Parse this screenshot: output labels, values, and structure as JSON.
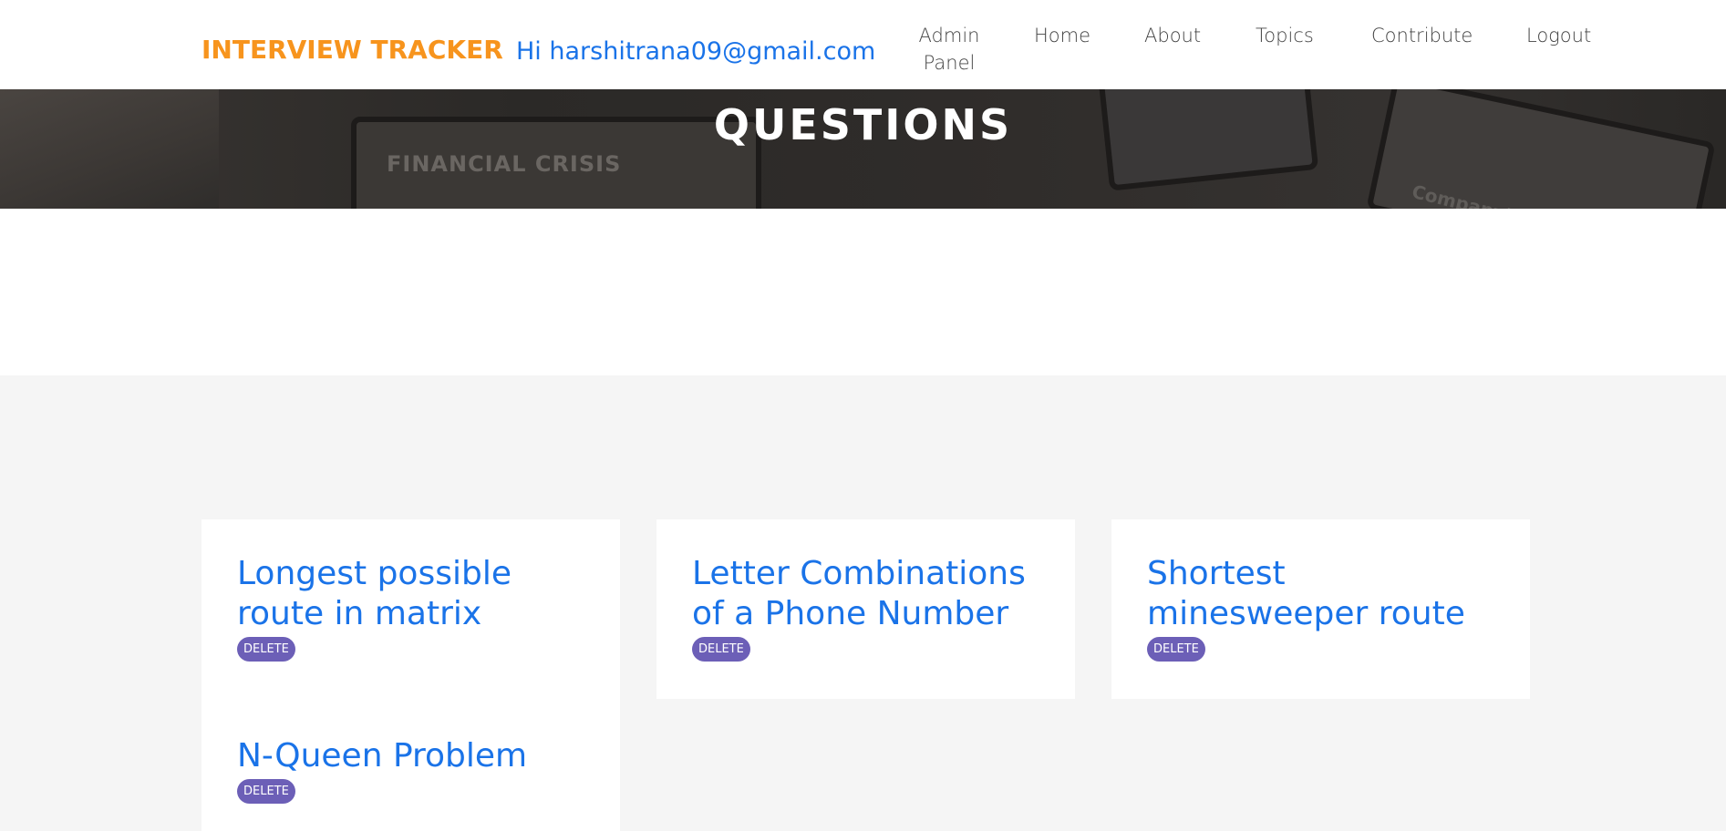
{
  "header": {
    "brand": "INTERVIEW TRACKER",
    "greeting": "Hi harshitrana09@gmail.com",
    "nav": {
      "admin_panel": "Admin Panel",
      "home": "Home",
      "about": "About",
      "topics": "Topics",
      "contribute": "Contribute",
      "logout": "Logout"
    }
  },
  "hero": {
    "title": "QUESTIONS",
    "background_text_1": "FINANCIAL CRISIS",
    "background_text_2": "Company's Gro"
  },
  "questions": [
    {
      "title": "Longest possible route in matrix",
      "action": "DELETE"
    },
    {
      "title": "Letter Combinations of a Phone Number",
      "action": "DELETE"
    },
    {
      "title": "Shortest minesweeper route",
      "action": "DELETE"
    },
    {
      "title": "N-Queen Problem",
      "action": "DELETE"
    }
  ],
  "colors": {
    "brand": "#f7941d",
    "link": "#1a73e8",
    "delete_button": "#6c5fb7",
    "content_bg": "#f5f5f5"
  }
}
